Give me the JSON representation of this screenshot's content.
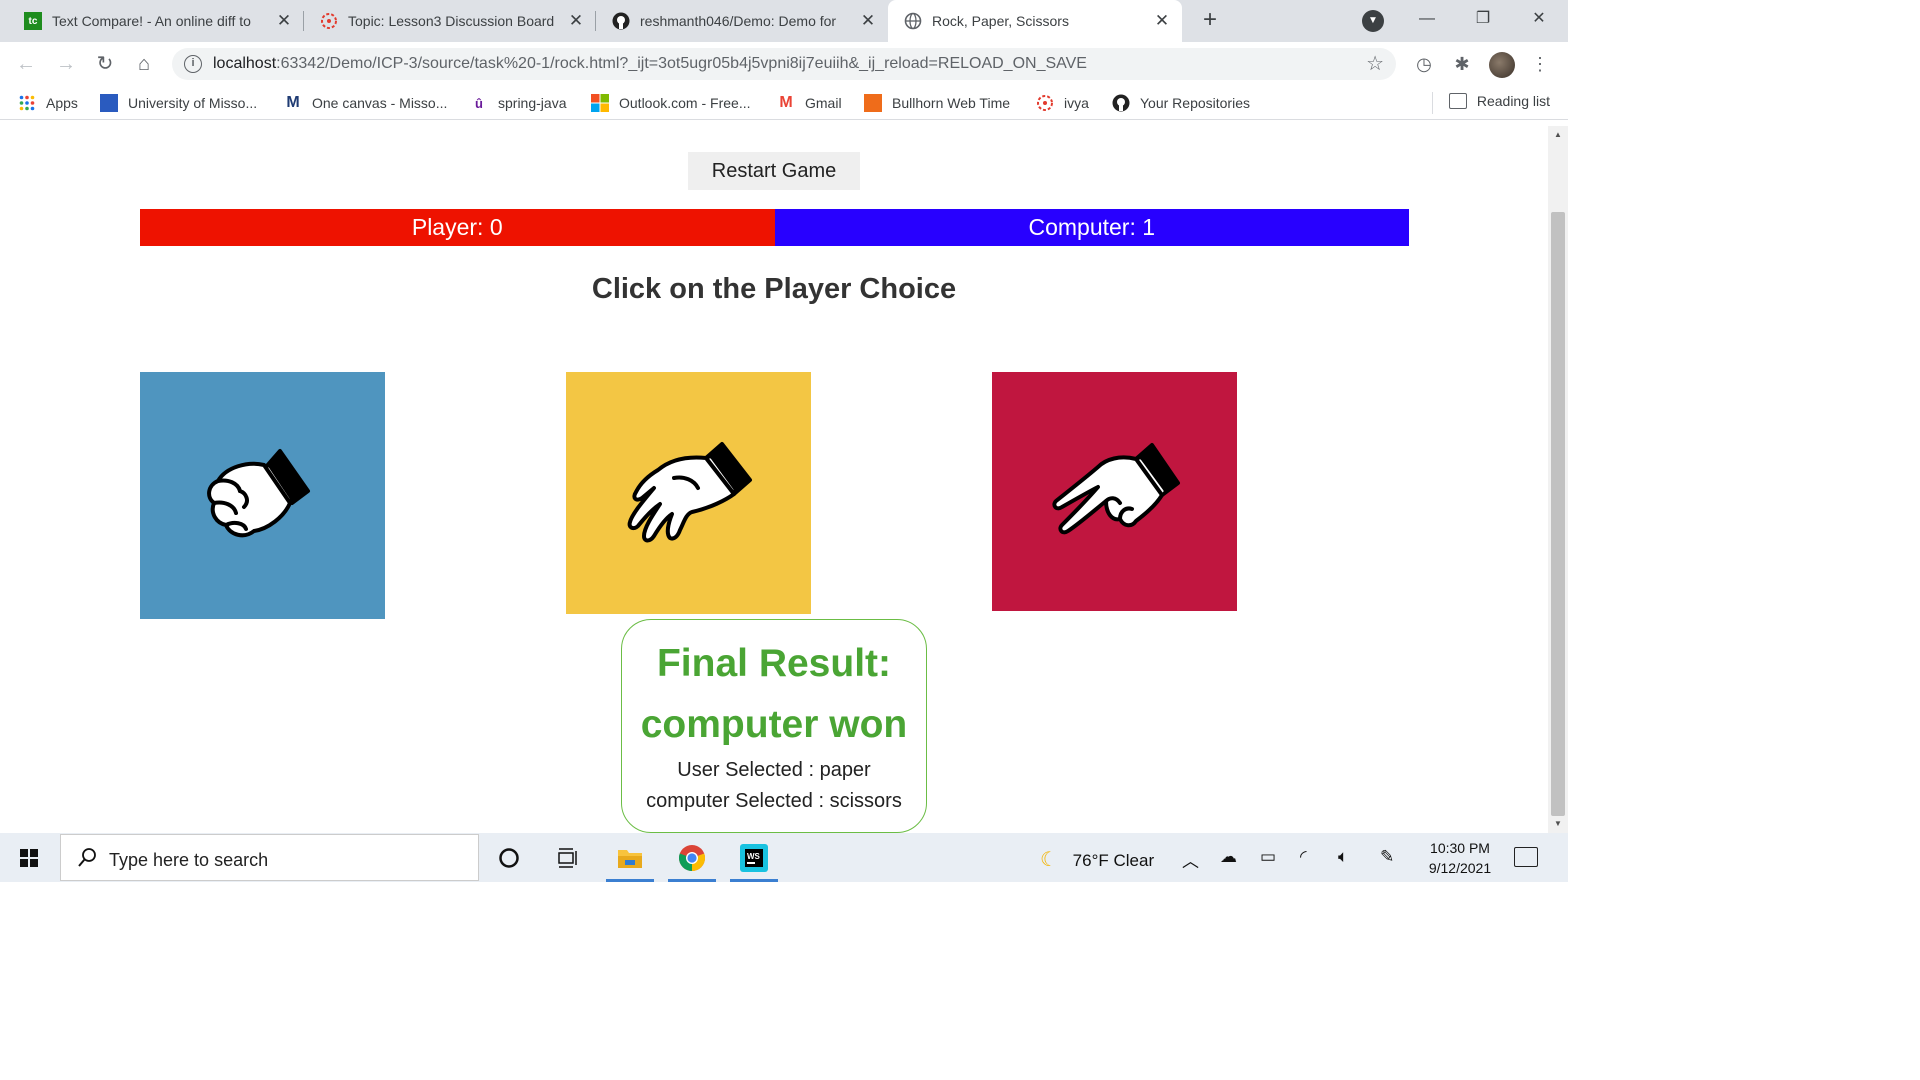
{
  "browser": {
    "tabs": [
      {
        "title": "Text Compare! - An online diff to",
        "icon": "text-compare-favicon"
      },
      {
        "title": "Topic: Lesson3 Discussion Board",
        "icon": "canvas-favicon"
      },
      {
        "title": "reshmanth046/Demo: Demo for",
        "icon": "github-favicon"
      },
      {
        "title": "Rock, Paper, Scissors",
        "icon": "globe-favicon"
      }
    ],
    "address": {
      "host": "localhost",
      "path": ":63342/Demo/ICP-3/source/task%20-1/rock.html?_ijt=3ot5ugr05b4j5vpni8ij7euiih&_ij_reload=RELOAD_ON_SAVE"
    },
    "bookmarks": [
      {
        "label": "Apps"
      },
      {
        "label": "University of Misso..."
      },
      {
        "label": "One canvas - Misso..."
      },
      {
        "label": "spring-java"
      },
      {
        "label": "Outlook.com - Free..."
      },
      {
        "label": "Gmail"
      },
      {
        "label": "Bullhorn Web Time"
      },
      {
        "label": "ivya"
      },
      {
        "label": "Your Repositories"
      }
    ],
    "reading_list": "Reading list"
  },
  "game": {
    "restart_label": "Restart Game",
    "player_score": "Player: 0",
    "computer_score": "Computer: 1",
    "heading": "Click on the Player Choice",
    "choices": [
      {
        "name": "rock",
        "color": "#4f95bf"
      },
      {
        "name": "paper",
        "color": "#f3c644"
      },
      {
        "name": "scissors",
        "color": "#c0163f"
      }
    ],
    "result": {
      "title": "Final Result:",
      "outcome": "computer won",
      "user_selected": "User Selected : paper",
      "computer_selected": "computer Selected : scissors"
    },
    "colors": {
      "player": "#ee1200",
      "computer": "#2800ff",
      "result_green": "#4aa534"
    }
  },
  "taskbar": {
    "search_placeholder": "Type here to search",
    "weather": "76°F  Clear",
    "time": "10:30 PM",
    "date": "9/12/2021"
  }
}
